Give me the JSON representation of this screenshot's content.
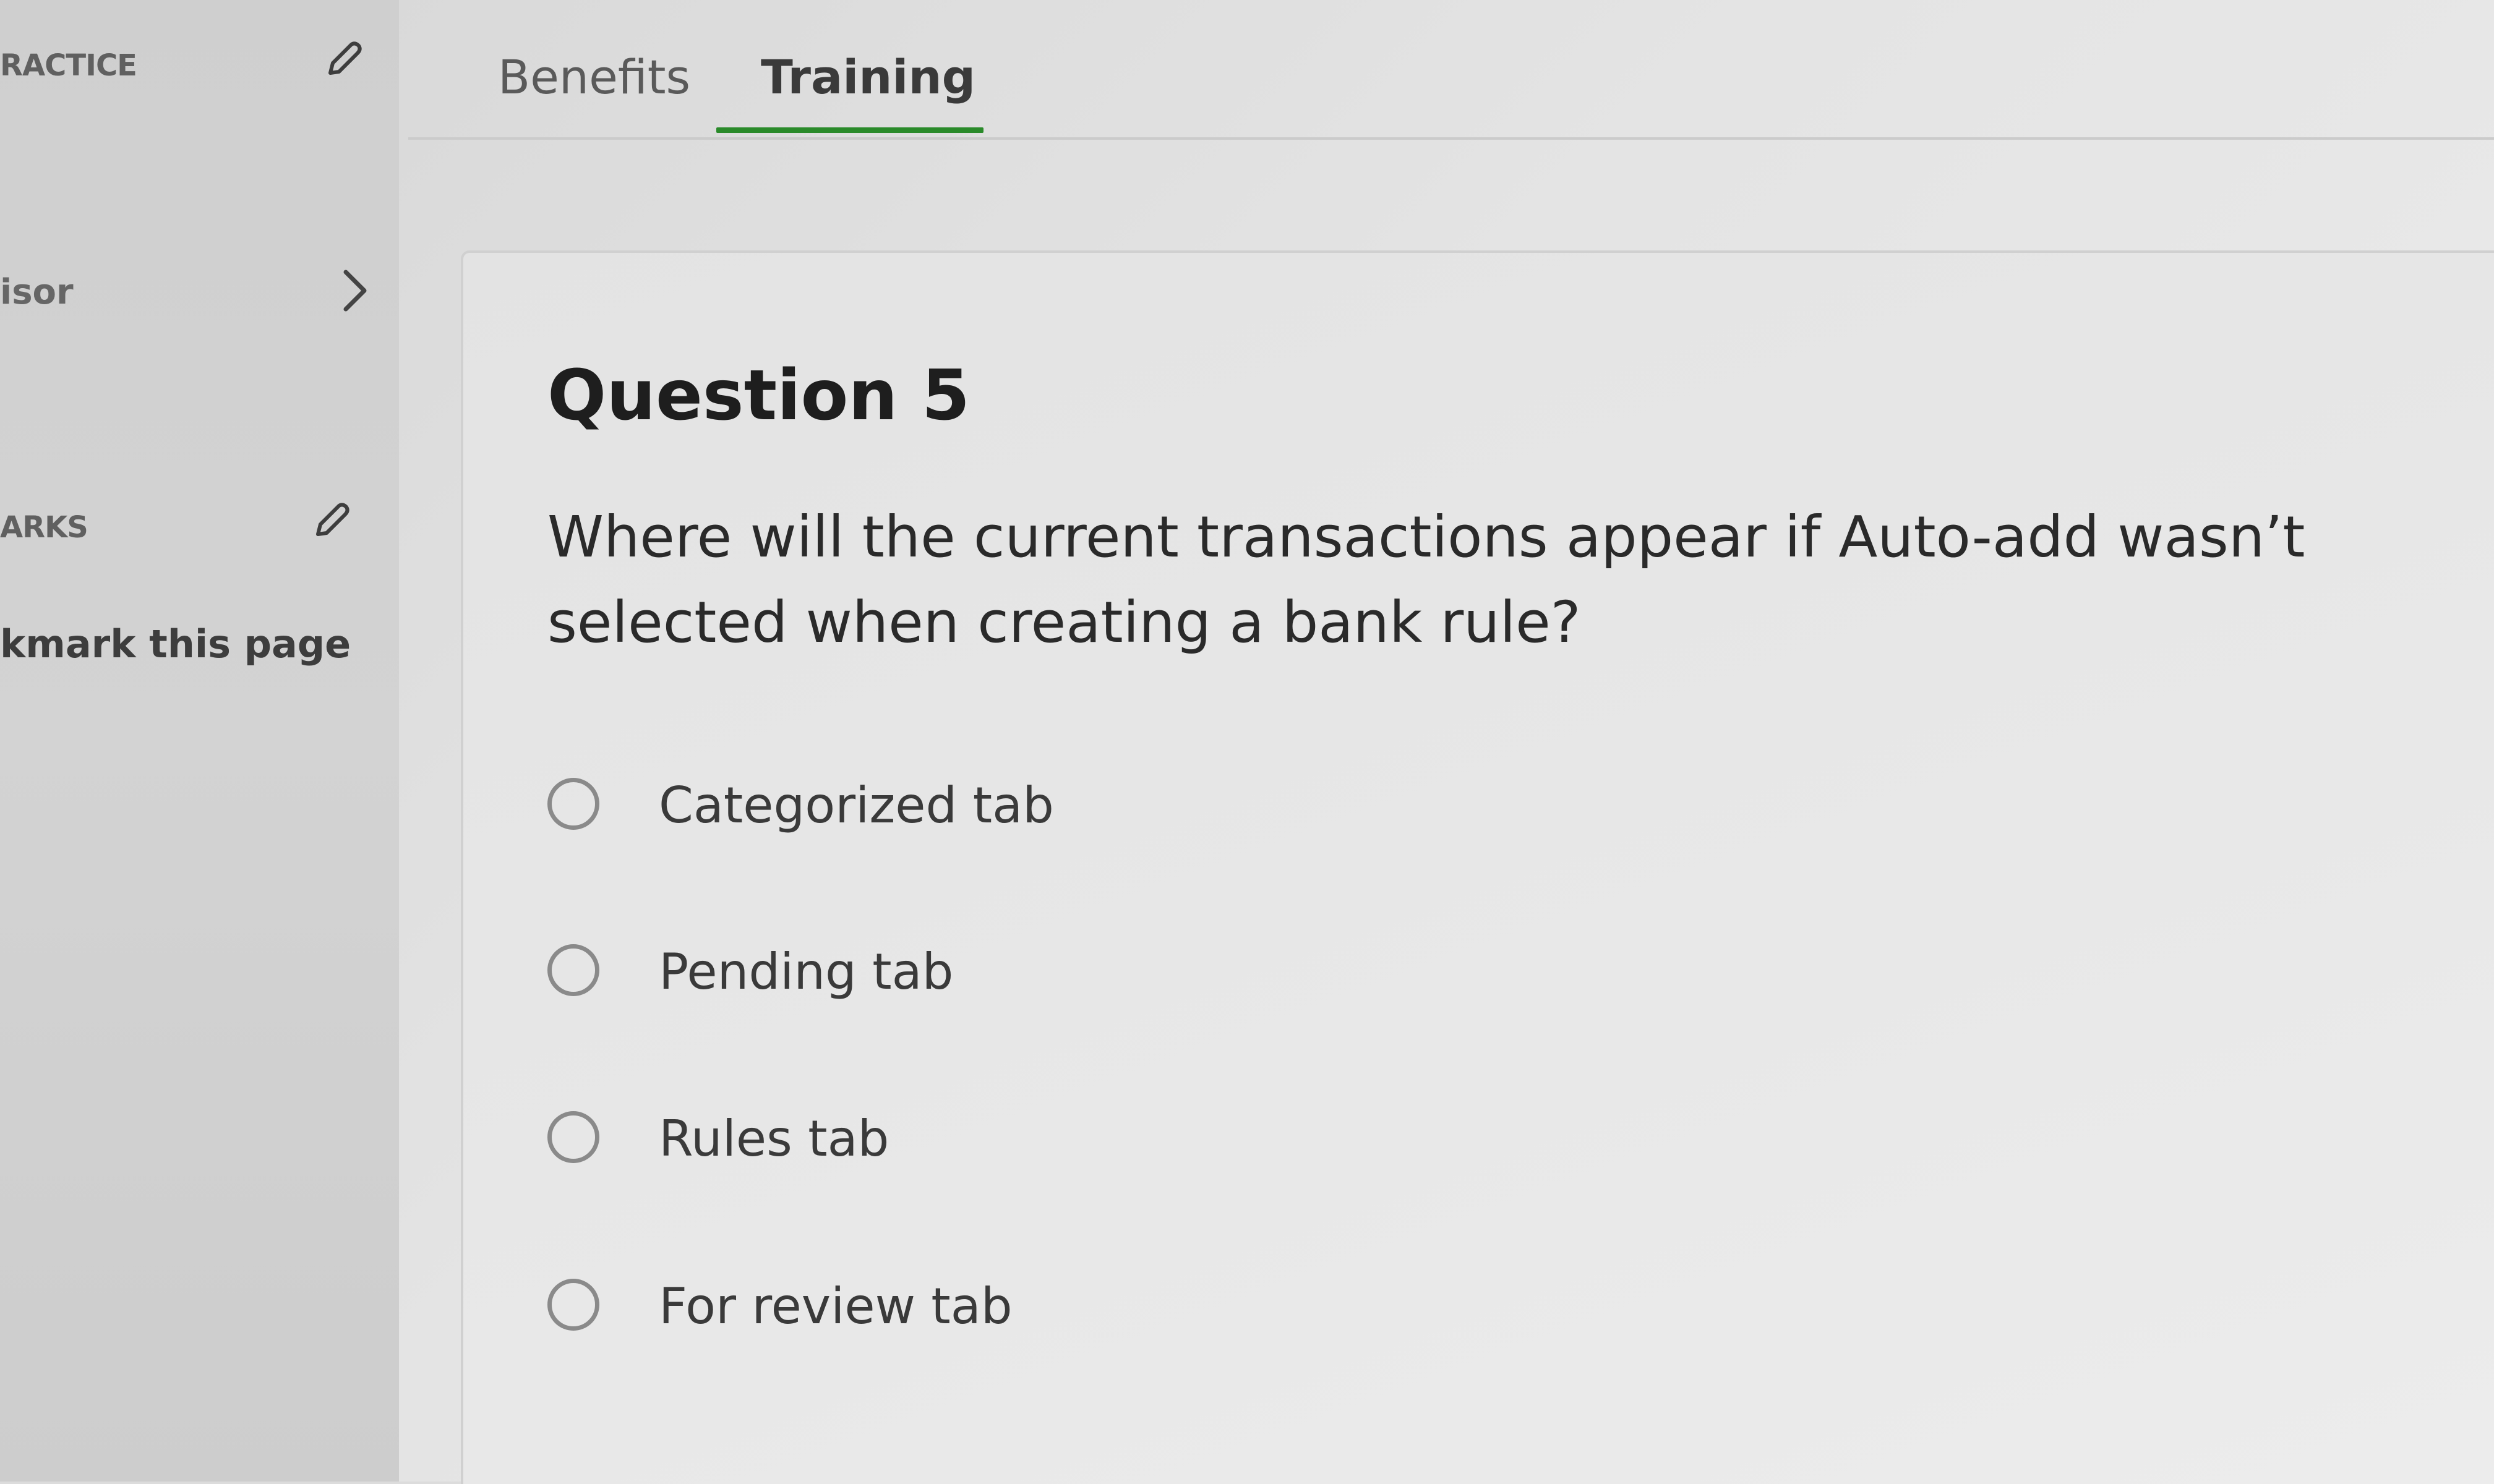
{
  "sidebar": {
    "items": [
      {
        "label": "RACTICE"
      },
      {
        "label": "isor"
      },
      {
        "label": "ARKS"
      },
      {
        "label": "kmark this page"
      }
    ]
  },
  "tabs": [
    {
      "label": "Benefits",
      "active": false
    },
    {
      "label": "Training",
      "active": true
    }
  ],
  "question": {
    "title": "Question 5",
    "text": "Where will the current transactions appear if Auto-add wasn’t selected when creating a bank rule?",
    "options": [
      {
        "label": "Categorized tab",
        "selected": false
      },
      {
        "label": "Pending tab",
        "selected": false
      },
      {
        "label": "Rules tab",
        "selected": false
      },
      {
        "label": "For review tab",
        "selected": false
      }
    ]
  },
  "colors": {
    "tab_underline": "#2a8a2a"
  }
}
